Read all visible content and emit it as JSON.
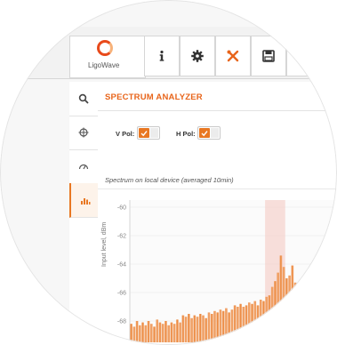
{
  "brand": {
    "name": "LigoWave",
    "accent": "#e8651b"
  },
  "toolbar": {
    "items": [
      {
        "name": "info-icon"
      },
      {
        "name": "gear-icon"
      },
      {
        "name": "tools-icon"
      },
      {
        "name": "save-icon"
      }
    ]
  },
  "sidebar": {
    "items": [
      {
        "name": "search-icon"
      },
      {
        "name": "crosshair-icon"
      },
      {
        "name": "gauge-icon"
      },
      {
        "name": "spectrum-icon",
        "active": true
      }
    ]
  },
  "page": {
    "title": "SPECTRUM ANALYZER"
  },
  "controls": {
    "v_pol_label": "V Pol:",
    "h_pol_label": "H Pol:",
    "v_pol_on": true,
    "h_pol_on": true
  },
  "chart_data": {
    "type": "bar",
    "title": "Spectrum on local device (averaged 10min)",
    "ylabel": "Input level, dBm",
    "yticks": [
      "-60",
      "-62",
      "-64",
      "-66",
      "-68"
    ],
    "ylim": [
      -69.5,
      -59.5
    ],
    "series": [
      {
        "values": [
          -68.2,
          -68.4,
          -68.0,
          -68.3,
          -68.1,
          -68.3,
          -68.0,
          -68.2,
          -68.4,
          -67.9,
          -68.1,
          -68.2,
          -68.0,
          -68.3,
          -68.1,
          -68.2,
          -67.9,
          -68.1,
          -67.6,
          -67.7,
          -67.5,
          -67.8,
          -67.6,
          -67.7,
          -67.5,
          -67.6,
          -67.8,
          -67.4,
          -67.5,
          -67.3,
          -67.4,
          -67.2,
          -67.3,
          -67.1,
          -67.4,
          -67.2,
          -66.9,
          -67.0,
          -66.8,
          -67.0,
          -66.9,
          -66.7,
          -66.8,
          -66.6,
          -66.9,
          -66.5,
          -66.6,
          -66.3,
          -66.2,
          -65.6,
          -65.2,
          -64.6,
          -63.4,
          -64.2,
          -65.0,
          -64.8,
          -64.1,
          -65.3,
          -65.7,
          -66.1,
          -66.3,
          -66.0,
          -66.2,
          -65.9,
          -66.1,
          -66.2,
          -65.8,
          -66.0,
          -65.9,
          -66.1,
          -65.8,
          -65.7
        ]
      }
    ],
    "highlight_range_index": [
      47,
      54
    ]
  }
}
